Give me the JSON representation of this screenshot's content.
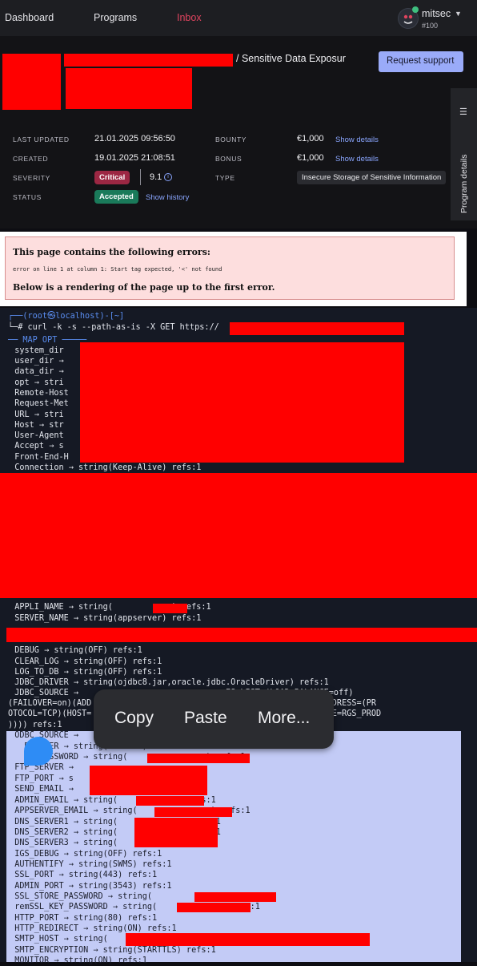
{
  "nav": {
    "links": [
      "Dashboard",
      "Programs",
      "Inbox"
    ],
    "user": {
      "name": "mitsec",
      "rank": "#100"
    }
  },
  "report": {
    "title_suffix": "/ Sensitive Data Exposur",
    "request_support": "Request support",
    "program_details_tab": "Program details",
    "fields": {
      "last_updated": {
        "label": "LAST UPDATED",
        "value": "21.01.2025 09:56:50"
      },
      "created": {
        "label": "CREATED",
        "value": "19.01.2025 21:08:51"
      },
      "severity": {
        "label": "SEVERITY",
        "badge": "Critical",
        "score": "9.1"
      },
      "status": {
        "label": "STATUS",
        "badge": "Accepted",
        "link": "Show history"
      },
      "bounty": {
        "label": "BOUNTY",
        "value": "€1,000",
        "link": "Show details"
      },
      "bonus": {
        "label": "BONUS",
        "value": "€1,000",
        "link": "Show details"
      },
      "type": {
        "label": "TYPE",
        "value": "Insecure Storage of Sensitive Information"
      }
    },
    "colors": {
      "critical": "#9c2743",
      "accepted": "#1a7a5a",
      "link": "#8aa6ff",
      "button": "#9aabf9"
    }
  },
  "xml_error": {
    "heading": "This page contains the following errors:",
    "detail": "error on line 1 at column 1: Start tag expected, '<' not found",
    "footer": "Below is a rendering of the page up to the first error."
  },
  "terminal": {
    "prompt_top": "┌──(root㉿localhost)-[~]",
    "prompt_cmd": "└─# curl -k -s --path-as-is -X GET https://",
    "lines": [
      "── MAP OPT ─────",
      "  system_dir",
      "  user_dir →",
      "  data_dir →",
      "  opt → stri",
      "  Remote-Host",
      "  Request-Met",
      "  URL → stri",
      "  Host → str",
      "  User-Agent",
      "  Accept → s",
      "  Front-End-H",
      "  Connection → string(Keep-Alive) refs:1",
      "  APPLI_NAME → string(            ) refs:1",
      "  SERVER_NAME → string(appserver) refs:1",
      "  DEBUG → string(OFF) refs:1",
      "  CLEAR_LOG → string(OFF) refs:1",
      "  LOG_TO_DB → string(OFF) refs:1",
      "  JDBC_DRIVER → string(ojdbc8.jar,oracle.jdbc.OracleDriver) refs:1",
      "  JDBC_SOURCE →                              ES_LIST=(LOAD_BALANCE=off)",
      "(FAILOVER=on)(ADD                                 )(PORT=1551))(ADDRESS=(PR",
      "OTOCOL=TCP)(HOST=                                  TA=(SERVICE_NAME=RGS_PROD",
      ")))) refs:1",
      "  ODBC_SOURCE →",
      "    DB_USER → string(       ) refs:1",
      "    DB_PASSWORD → string(                ) refs:1",
      "  FTP_SERVER →",
      "  FTP_PORT → s",
      "  SEND_EMAIL →",
      "  ADMIN_EMAIL → string(            ) refs:1",
      "  APPSERVER_EMAIL → string(               ) refs:1",
      "  DNS_SERVER1 → string(              )refs:1",
      "  DNS_SERVER2 → string(              )refs:1",
      "  DNS_SERVER3 → string(",
      "  IGS_DEBUG → string(OFF) refs:1",
      "  AUTHENTIFY → string(SWMS) refs:1",
      "  SSL_PORT → string(443) refs:1",
      "  ADMIN_PORT → string(3543) refs:1",
      "  SSL_STORE_PASSWORD → string(                ) refs:1",
      "  remSSL_KEY_PASSWORD → string(             ) refs:1",
      "  HTTP_PORT → string(80) refs:1",
      "  HTTP_REDIRECT → string(ON) refs:1",
      "  SMTP_HOST → string(                                          ) refs:1",
      "  SMTP_ENCRYPTION → string(STARTTLS) refs:1",
      "  MONITOR → string(ON) refs:1"
    ]
  },
  "context_menu": {
    "items": [
      "Copy",
      "Paste",
      "More..."
    ]
  }
}
